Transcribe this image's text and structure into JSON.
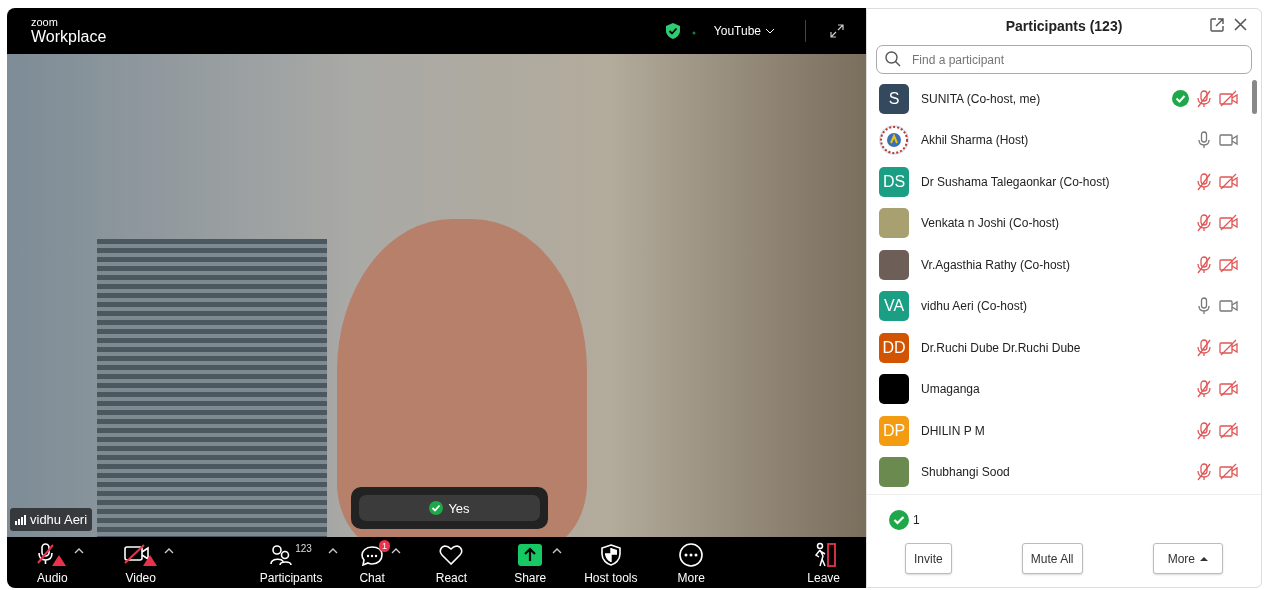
{
  "meeting": {
    "logo_small": "zoom",
    "logo_large": "Workplace",
    "stream": "YouTube",
    "speaker": "vidhu Aeri",
    "reaction": "Yes"
  },
  "toolbar": [
    {
      "kind": "audio",
      "label": "Audio",
      "caret": true,
      "warning": true
    },
    {
      "kind": "video",
      "label": "Video",
      "caret": true,
      "warning": true
    },
    {
      "kind": "participants",
      "label": "Participants",
      "count": "123",
      "caret": true
    },
    {
      "kind": "chat",
      "label": "Chat",
      "badge": "1",
      "caret": true
    },
    {
      "kind": "react",
      "label": "React",
      "caret": false
    },
    {
      "kind": "share",
      "label": "Share",
      "caret": true
    },
    {
      "kind": "hosttools",
      "label": "Host tools",
      "caret": false
    },
    {
      "kind": "more",
      "label": "More",
      "caret": false
    },
    {
      "kind": "leave",
      "label": "Leave",
      "caret": false
    }
  ],
  "panel": {
    "title": "Participants (123)",
    "search": {
      "placeholder": "Find a participant"
    },
    "participants": [
      {
        "name": "SUNITA (Co-host, me)",
        "kind": "initials",
        "initials": "S",
        "color": "#34495e",
        "yes": true,
        "muted": true,
        "video_off": true
      },
      {
        "name": "Akhil Sharma (Host)",
        "kind": "logo",
        "color": "#d9e4f0",
        "yes": false,
        "muted": false,
        "video_off": false
      },
      {
        "name": "Dr Sushama Talegaonkar (Co-host)",
        "kind": "initials",
        "initials": "DS",
        "color": "#1a9e84",
        "yes": false,
        "muted": true,
        "video_off": true
      },
      {
        "name": "Venkata n Joshi (Co-host)",
        "kind": "photo",
        "color": "#a8a070",
        "yes": false,
        "muted": true,
        "video_off": true
      },
      {
        "name": "Vr.Agasthia Rathy (Co-host)",
        "kind": "photo",
        "color": "#6e5e58",
        "yes": false,
        "muted": true,
        "video_off": true
      },
      {
        "name": "vidhu Aeri (Co-host)",
        "kind": "initials",
        "initials": "VA",
        "color": "#1a9e84",
        "yes": false,
        "muted": false,
        "video_off": false
      },
      {
        "name": "Dr.Ruchi Dube Dr.Ruchi Dube",
        "kind": "initials",
        "initials": "DD",
        "color": "#d35400",
        "yes": false,
        "muted": true,
        "video_off": true
      },
      {
        "name": "Umaganga",
        "kind": "photo",
        "color": "#000000",
        "yes": false,
        "muted": true,
        "video_off": true
      },
      {
        "name": "DHILIN P M",
        "kind": "initials",
        "initials": "DP",
        "color": "#f39c12",
        "yes": false,
        "muted": true,
        "video_off": true
      },
      {
        "name": "Shubhangi Sood",
        "kind": "photo",
        "color": "#6a8a50",
        "yes": false,
        "muted": true,
        "video_off": true
      }
    ],
    "yes_count": "1",
    "buttons": [
      "Invite",
      "Mute All",
      "More"
    ]
  }
}
